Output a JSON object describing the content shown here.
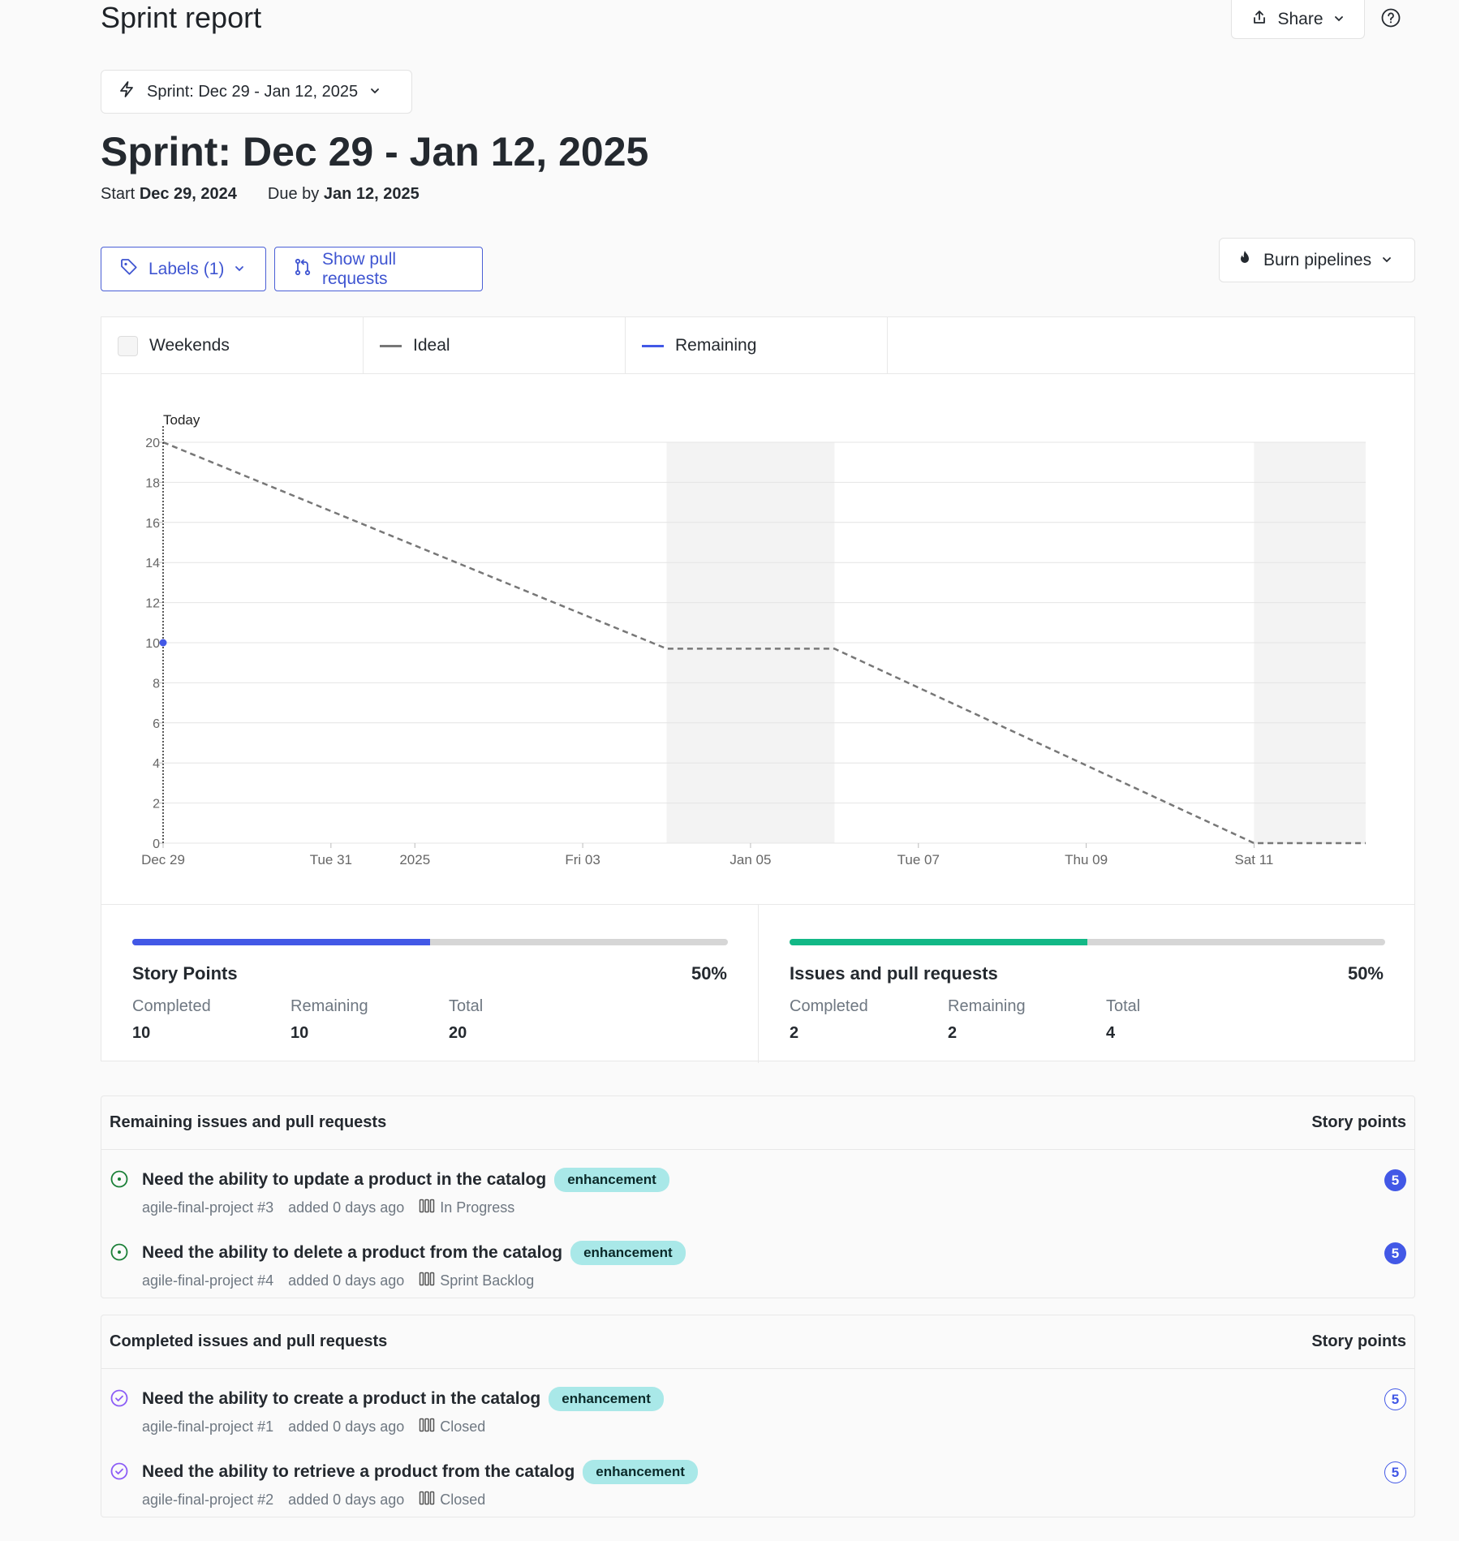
{
  "header": {
    "title": "Sprint report",
    "share_label": "Share"
  },
  "sprint_selector": {
    "label": "Sprint: Dec 29 - Jan 12, 2025"
  },
  "sprint": {
    "heading": "Sprint: Dec 29 - Jan 12, 2025",
    "start_label": "Start",
    "start_date": "Dec 29, 2024",
    "due_label": "Due by",
    "due_date": "Jan 12, 2025"
  },
  "filters": {
    "labels_button": "Labels (1)",
    "pull_requests_button": "Show pull requests",
    "burn_button": "Burn pipelines"
  },
  "legend": {
    "weekends": "Weekends",
    "ideal": "Ideal",
    "remaining": "Remaining"
  },
  "colors": {
    "accent": "#4258e6",
    "success": "#12b886",
    "ideal_line": "#777777",
    "badge_bg": "#a9e8e8",
    "closed_icon": "#8b5cf6",
    "open_icon": "#1a7f37"
  },
  "chart_data": {
    "type": "line",
    "today_label": "Today",
    "x_ticks": [
      "Dec 29",
      "Tue 31",
      "2025",
      "Fri 03",
      "Jan 05",
      "Tue 07",
      "Thu 09",
      "Sat 11"
    ],
    "x_tick_days": [
      0,
      2,
      3,
      5,
      7,
      9,
      11,
      13
    ],
    "x_range_days": [
      0,
      14.33
    ],
    "ylim": [
      0,
      20
    ],
    "y_ticks": [
      0,
      2,
      4,
      6,
      8,
      10,
      12,
      14,
      16,
      18,
      20
    ],
    "weekend_bands_days": [
      [
        6,
        8
      ],
      [
        13,
        14.33
      ]
    ],
    "series": [
      {
        "name": "Ideal",
        "style": "dashed",
        "points_days": [
          [
            0,
            20
          ],
          [
            6,
            9.7
          ],
          [
            8,
            9.7
          ],
          [
            13,
            0
          ],
          [
            14.33,
            0
          ]
        ]
      },
      {
        "name": "Remaining",
        "style": "solid",
        "points_days": [
          [
            0,
            10
          ]
        ]
      }
    ],
    "today_day": 0
  },
  "stats": {
    "story_points": {
      "title": "Story Points",
      "percent_label": "50%",
      "percent": 50,
      "completed_label": "Completed",
      "completed": "10",
      "remaining_label": "Remaining",
      "remaining": "10",
      "total_label": "Total",
      "total": "20"
    },
    "issues": {
      "title": "Issues and pull requests",
      "percent_label": "50%",
      "percent": 50,
      "completed_label": "Completed",
      "completed": "2",
      "remaining_label": "Remaining",
      "remaining": "2",
      "total_label": "Total",
      "total": "4"
    }
  },
  "remaining_list": {
    "title": "Remaining issues and pull requests",
    "points_header": "Story points",
    "items": [
      {
        "title": "Need the ability to update a product in the catalog",
        "label": "enhancement",
        "repo": "agile-final-project",
        "number": "#3",
        "added": "added 0 days ago",
        "pipeline": "In Progress",
        "points": "5"
      },
      {
        "title": "Need the ability to delete a product from the catalog",
        "label": "enhancement",
        "repo": "agile-final-project",
        "number": "#4",
        "added": "added 0 days ago",
        "pipeline": "Sprint Backlog",
        "points": "5"
      }
    ]
  },
  "completed_list": {
    "title": "Completed issues and pull requests",
    "points_header": "Story points",
    "items": [
      {
        "title": "Need the ability to create a product in the catalog",
        "label": "enhancement",
        "repo": "agile-final-project",
        "number": "#1",
        "added": "added 0 days ago",
        "pipeline": "Closed",
        "points": "5"
      },
      {
        "title": "Need the ability to retrieve a product from the catalog",
        "label": "enhancement",
        "repo": "agile-final-project",
        "number": "#2",
        "added": "added 0 days ago",
        "pipeline": "Closed",
        "points": "5"
      }
    ]
  }
}
